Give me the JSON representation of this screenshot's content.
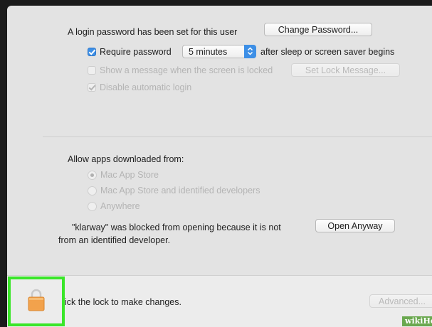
{
  "password": {
    "status_text": "A login password has been set for this user",
    "change_button": "Change Password...",
    "require_label": "Require password",
    "require_delay": "5 minutes",
    "require_suffix": "after sleep or screen saver begins",
    "show_message_label": "Show a message when the screen is locked",
    "set_lock_button": "Set Lock Message...",
    "disable_login_label": "Disable automatic login"
  },
  "gatekeeper": {
    "heading": "Allow apps downloaded from:",
    "options": [
      "Mac App Store",
      "Mac App Store and identified developers",
      "Anywhere"
    ],
    "selected_index": 0,
    "blocked_line1": "\"klarway\" was blocked from opening because it is not",
    "blocked_line2": "from an identified developer.",
    "open_anyway_button": "Open Anyway"
  },
  "footer": {
    "lock_text": "ick the lock to make changes.",
    "advanced_button": "Advanced..."
  },
  "watermark": "wikiHo",
  "colors": {
    "accent": "#3d8fe6",
    "highlight": "#3ae629",
    "lock": "#f0a04b"
  }
}
